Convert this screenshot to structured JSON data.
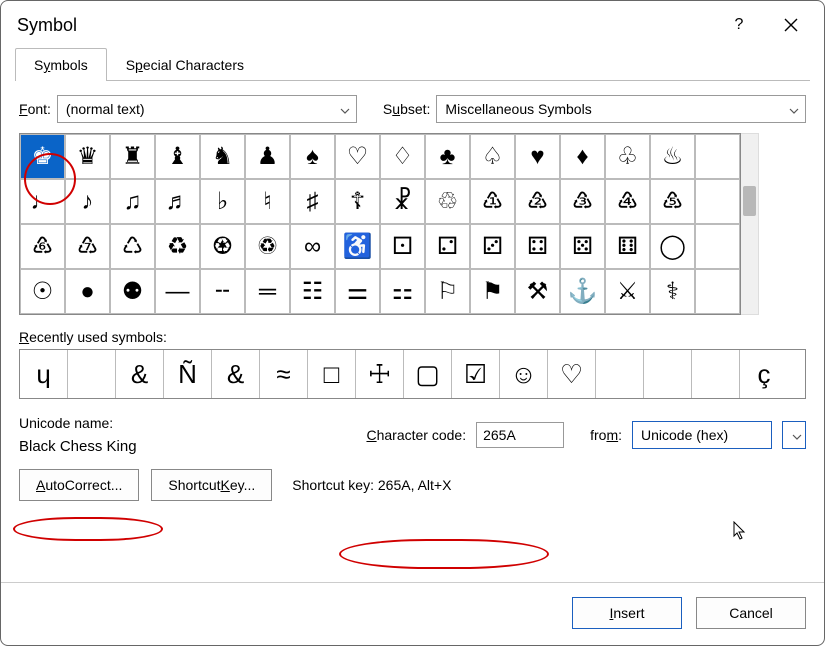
{
  "dialog": {
    "title": "Symbol"
  },
  "tabs": [
    {
      "label_pre": "S",
      "label_u": "y",
      "label_post": "mbols",
      "active": true
    },
    {
      "label_pre": "S",
      "label_u": "p",
      "label_post": "ecial Characters",
      "active": false
    }
  ],
  "font": {
    "label_pre": "",
    "label_u": "F",
    "label_post": "ont:",
    "value": "(normal text)"
  },
  "subset": {
    "label_pre": "S",
    "label_u": "u",
    "label_post": "bset:",
    "value": "Miscellaneous Symbols"
  },
  "grid": {
    "cols": 16,
    "rows": 4,
    "selected_index": 0,
    "cells": [
      "♚",
      "♛",
      "♜",
      "♝",
      "♞",
      "♟",
      "♠",
      "♡",
      "♢",
      "♣",
      "♤",
      "♥",
      "♦",
      "♧",
      "♨",
      "",
      "♩",
      "♪",
      "♫",
      "♬",
      "♭",
      "♮",
      "♯",
      "☦",
      "☧",
      "♲",
      "♳",
      "♴",
      "♵",
      "♶",
      "♷",
      "",
      "♸",
      "♹",
      "♺",
      "♻",
      "♼",
      "♽",
      "∞",
      "♿",
      "⚀",
      "⚁",
      "⚂",
      "⚃",
      "⚄",
      "⚅",
      "◯",
      "",
      "☉",
      "●",
      "⚉",
      "—",
      "╌",
      "═",
      "☷",
      "⚌",
      "⚏",
      "⚐",
      "⚑",
      "⚒",
      "⚓",
      "⚔",
      "⚕",
      ""
    ]
  },
  "recent": {
    "label_pre": "",
    "label_u": "R",
    "label_post": "ecently used symbols:",
    "items": [
      "ɥ",
      "",
      "&",
      "Ñ",
      "&",
      "≈",
      "□",
      "☩",
      "▢",
      "☑",
      "☺",
      "♡",
      "",
      "",
      "",
      "ç"
    ]
  },
  "unicode": {
    "label": "Unicode name:",
    "name": "Black Chess King"
  },
  "charcode": {
    "label_pre": "",
    "label_u": "C",
    "label_post": "haracter code:",
    "value": "265A"
  },
  "from": {
    "label_pre": "fro",
    "label_u": "m",
    "label_post": ":",
    "value": "Unicode (hex)"
  },
  "buttons": {
    "autocorrect_pre": "",
    "autocorrect_u": "A",
    "autocorrect_post": "utoCorrect...",
    "shortcutkey_pre": "Shortcut ",
    "shortcutkey_u": "K",
    "shortcutkey_post": "ey...",
    "shortcut_info": "Shortcut key: 265A, Alt+X",
    "insert_pre": "",
    "insert_u": "I",
    "insert_post": "nsert",
    "cancel": "Cancel"
  }
}
